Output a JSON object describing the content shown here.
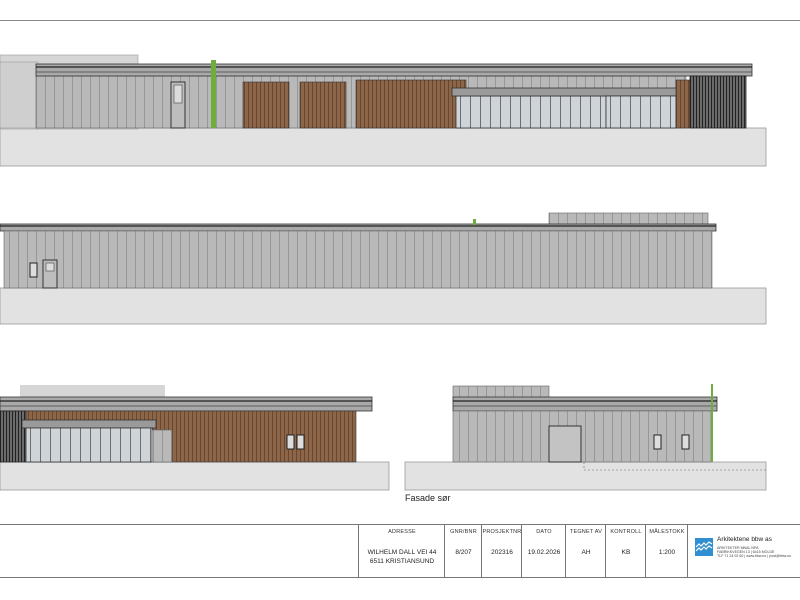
{
  "drawing": {
    "caption": "Fasade sør"
  },
  "title_block": {
    "address_label": "ADRESSE",
    "address_line1": "WILHELM DALL VEI 44",
    "address_line2": "6511 KRISTIANSUND",
    "gnr_label": "GNR/BNR",
    "gnr_value": "8/207",
    "project_label": "PROSJEKTNR",
    "project_value": "202316",
    "date_label": "DATO",
    "date_value": "19.02.2026",
    "drawn_label": "TEGNET AV",
    "drawn_value": "AH",
    "check_label": "KONTROLL",
    "check_value": "KB",
    "scale_label": "MÅLESTOKK",
    "scale_value": "1:200"
  },
  "firm": {
    "name": "Arkitektene bbw as",
    "line1": "ARKITEKTER MNAL NPA",
    "line2": "FABRIKKVEGEN 13 | 6415 MOLDE",
    "line3": "TLF 71 24 02 60 | www.bbw.no | post@bbw.no"
  },
  "colors": {
    "cladding": "#b9b9b9",
    "ground": "#e2e2e2",
    "wood": "#8d6549",
    "glass": "#c9ced2",
    "accent_green": "#6fae3c",
    "logo_blue": "#2f8fd0"
  }
}
